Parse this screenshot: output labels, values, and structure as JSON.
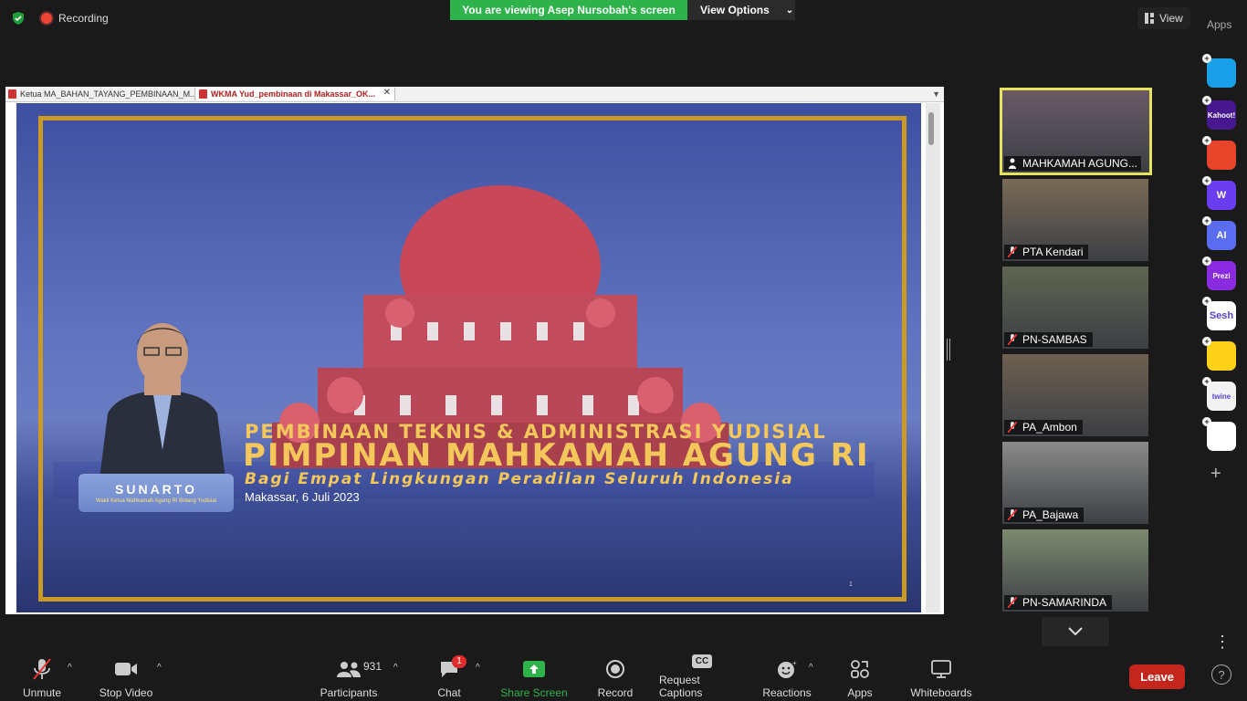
{
  "top_bar": {
    "recording_label": "Recording",
    "viewing_banner": "You are viewing Asep Nursobah's screen",
    "view_options_label": "View Options",
    "view_label": "View",
    "apps_label": "Apps"
  },
  "document": {
    "tabs": [
      {
        "label": "Ketua MA_BAHAN_TAYANG_PEMBINAAN_M..."
      },
      {
        "label": "WKMA Yud_pembinaan di Makassar_OK..."
      }
    ],
    "slide": {
      "speaker_name": "SUNARTO",
      "speaker_title": "Wakil Ketua Mahkamah Agung RI Bidang Yudisial",
      "line1": "PEMBINAAN TEKNIS & ADMINISTRASI YUDISIAL",
      "line2": "PIMPINAN MAHKAMAH AGUNG RI",
      "line3": "Bagi Empat Lingkungan Peradilan Seluruh Indonesia",
      "place_date": "Makassar, 6 Juli 2023",
      "page_number": "1"
    }
  },
  "participants": [
    {
      "name": "MAHKAMAH AGUNG...",
      "color": "#6a5a66"
    },
    {
      "name": "PTA Kendari",
      "color": "#7a6a55"
    },
    {
      "name": "PN-SAMBAS",
      "color": "#5e6650"
    },
    {
      "name": "PA_Ambon",
      "color": "#6e6050"
    },
    {
      "name": "PA_Bajawa",
      "color": "#8a8a88"
    },
    {
      "name": "PN-SAMARINDA",
      "color": "#7d8a70"
    }
  ],
  "apps_rail": [
    {
      "label": "",
      "icon": "play-app-icon",
      "color": "#1aa0e8"
    },
    {
      "label": "Kahoot!",
      "icon": "kahoot-icon",
      "color": "#46178f"
    },
    {
      "label": "",
      "icon": "red-app-icon",
      "color": "#e8442a"
    },
    {
      "label": "W",
      "icon": "wooclap-icon",
      "color": "#6a3df0"
    },
    {
      "label": "AI",
      "icon": "ai-app-icon",
      "color": "#5a6cf0"
    },
    {
      "label": "Prezi",
      "icon": "prezi-icon",
      "color": "#8a2be2"
    },
    {
      "label": "Sesh",
      "icon": "sesh-icon",
      "color": "#ffffff"
    },
    {
      "label": "",
      "icon": "emoji-app-icon",
      "color": "#ffd21a"
    },
    {
      "label": "twine",
      "icon": "twine-icon",
      "color": "#f2f2f2"
    },
    {
      "label": "",
      "icon": "blocks-app-icon",
      "color": "#ffffff"
    }
  ],
  "toolbar": {
    "unmute": "Unmute",
    "stop_video": "Stop Video",
    "participants": "Participants",
    "participant_count": "931",
    "chat": "Chat",
    "chat_badge": "1",
    "share_screen": "Share Screen",
    "record": "Record",
    "request_captions": "Request Captions",
    "cc": "CC",
    "reactions": "Reactions",
    "apps": "Apps",
    "whiteboards": "Whiteboards",
    "leave": "Leave",
    "help": "?"
  }
}
